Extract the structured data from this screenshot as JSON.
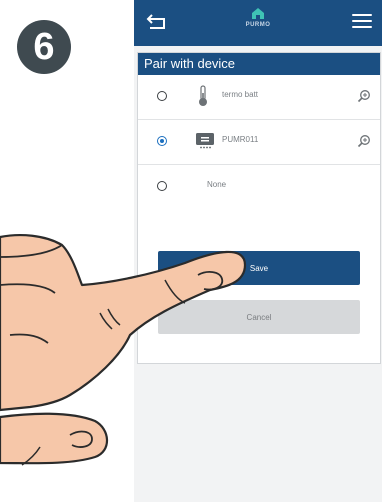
{
  "step": {
    "number": "6"
  },
  "app": {
    "brand": "PURMO"
  },
  "pair_panel": {
    "title": "Pair with device",
    "devices": [
      {
        "label": "termo batt",
        "icon": "thermometer-icon",
        "selected": false
      },
      {
        "label": "PUMR011",
        "icon": "device-module-icon",
        "selected": true
      },
      {
        "label": "None",
        "icon": "",
        "selected": false
      }
    ],
    "save_label": "Save",
    "cancel_label": "Cancel"
  },
  "colors": {
    "primary": "#1b4f82",
    "selected_radio": "#1b6fbf",
    "badge": "#3f4a50"
  }
}
